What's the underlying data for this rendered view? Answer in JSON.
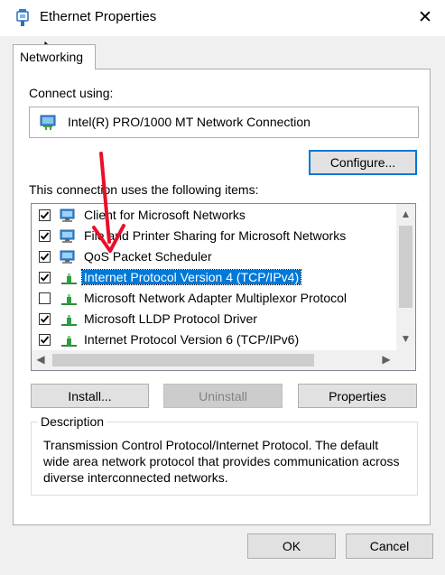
{
  "window": {
    "title": "Ethernet Properties",
    "close_label": "✕"
  },
  "tabs": [
    {
      "label": "Networking",
      "selected": true
    }
  ],
  "connect_using": {
    "label": "Connect using:",
    "adapter": "Intel(R) PRO/1000 MT Network Connection",
    "configure_label": "Configure..."
  },
  "items": {
    "label": "This connection uses the following items:",
    "list": [
      {
        "label": "Client for Microsoft Networks",
        "checked": true,
        "icon": "network-client-icon",
        "selected": false
      },
      {
        "label": "File and Printer Sharing for Microsoft Networks",
        "checked": true,
        "icon": "network-service-icon",
        "selected": false
      },
      {
        "label": "QoS Packet Scheduler",
        "checked": true,
        "icon": "network-service-icon",
        "selected": false
      },
      {
        "label": "Internet Protocol Version 4 (TCP/IPv4)",
        "checked": true,
        "icon": "network-protocol-icon",
        "selected": true
      },
      {
        "label": "Microsoft Network Adapter Multiplexor Protocol",
        "checked": false,
        "icon": "network-protocol-icon",
        "selected": false
      },
      {
        "label": "Microsoft LLDP Protocol Driver",
        "checked": true,
        "icon": "network-protocol-icon",
        "selected": false
      },
      {
        "label": "Internet Protocol Version 6 (TCP/IPv6)",
        "checked": true,
        "icon": "network-protocol-icon",
        "selected": false
      }
    ]
  },
  "actions": {
    "install_label": "Install...",
    "uninstall_label": "Uninstall",
    "properties_label": "Properties"
  },
  "description": {
    "legend": "Description",
    "text": "Transmission Control Protocol/Internet Protocol. The default wide area network protocol that provides communication across diverse interconnected networks."
  },
  "footer": {
    "ok_label": "OK",
    "cancel_label": "Cancel"
  },
  "colors": {
    "selection": "#0078d7",
    "annotation_arrow": "#e8102a",
    "dialog_background": "#f0f0f0"
  }
}
